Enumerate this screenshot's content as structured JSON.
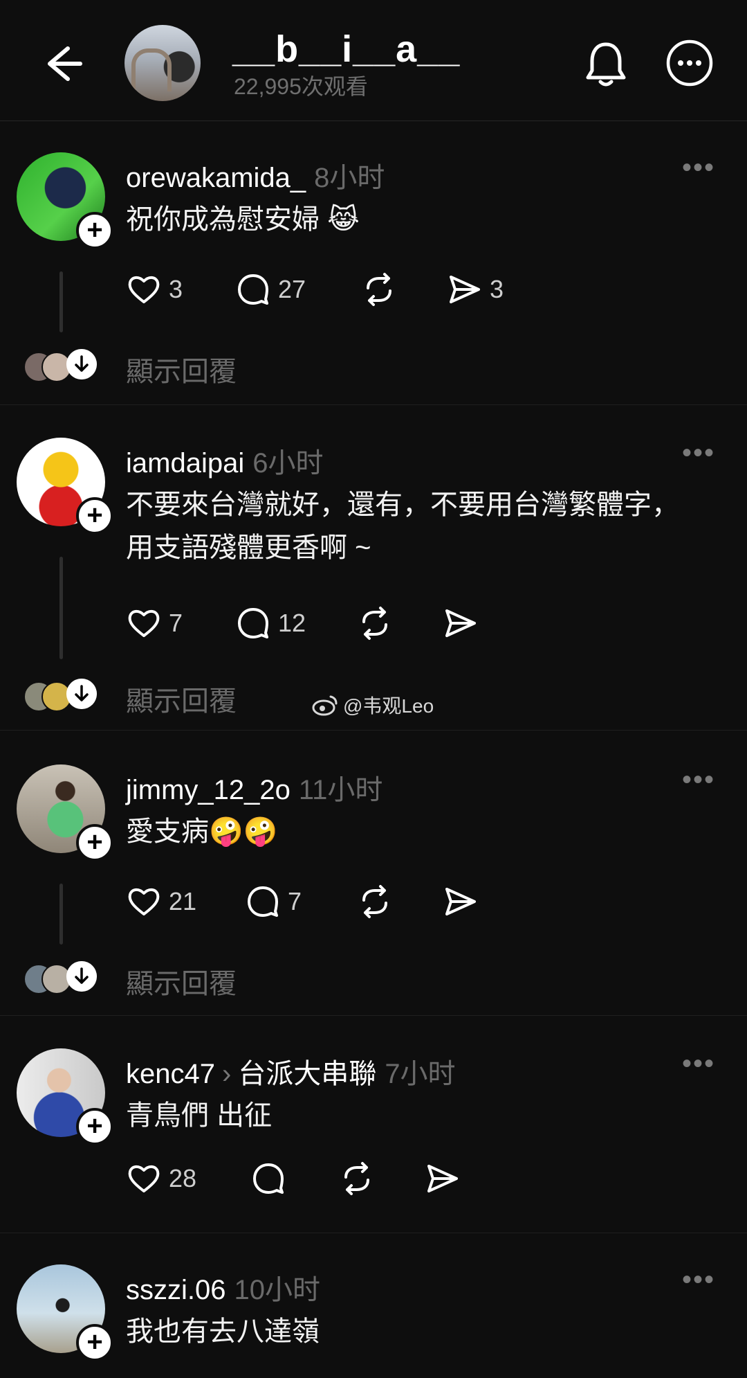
{
  "header": {
    "title": "__b__i__a__",
    "views": "22,995次观看",
    "avatar_icon": "profile-avatar-icon"
  },
  "posts": [
    {
      "username": "orewakamida_",
      "time": "8小时",
      "text": "祝你成為慰安婦 😹",
      "likes": "3",
      "comments": "27",
      "reposts": "",
      "shares": "3",
      "show_replies": "顯示回覆"
    },
    {
      "username": "iamdaipai",
      "time": "6小时",
      "text": "不要來台灣就好，還有，不要用台灣繁體字，用支語殘體更香啊 ~",
      "likes": "7",
      "comments": "12",
      "reposts": "",
      "shares": "",
      "show_replies": "顯示回覆"
    },
    {
      "username": "jimmy_12_2o",
      "time": "11小时",
      "text": "愛支病🤪🤪",
      "likes": "21",
      "comments": "7",
      "reposts": "",
      "shares": "",
      "show_replies": "顯示回覆"
    },
    {
      "username": "kenc47",
      "community": "台派大串聯",
      "time": "7小时",
      "text": "青鳥們 出征",
      "likes": "28",
      "comments": "",
      "reposts": "",
      "shares": ""
    },
    {
      "username": "sszzi.06",
      "time": "10小时",
      "text": "我也有去八達嶺"
    }
  ],
  "watermark": "@韦观Leo",
  "colors": {
    "background": "#0e0e0e",
    "text": "#f2f2f2",
    "muted": "#6a6a6a"
  }
}
